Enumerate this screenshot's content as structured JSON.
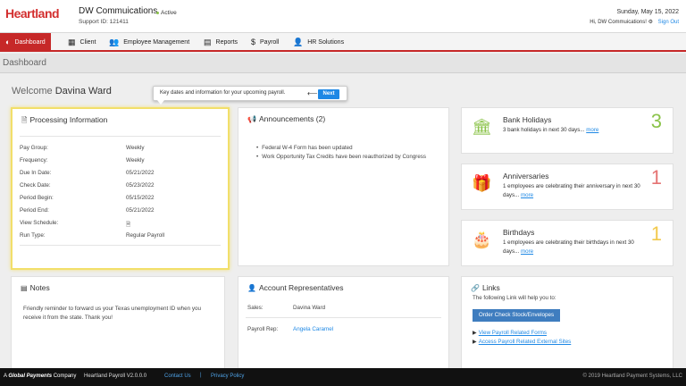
{
  "header": {
    "logo": "Heartland",
    "company": "DW Commuications",
    "status": "Active",
    "support_id": "Support ID: 121411",
    "date": "Sunday, May 15, 2022",
    "greeting": "Hi, DW Commuications!",
    "sign_out": "Sign Out"
  },
  "nav": [
    {
      "label": "Dashboard",
      "icon": "dashboard-icon",
      "glyph": "◐"
    },
    {
      "label": "Client",
      "icon": "building-icon",
      "glyph": "▦"
    },
    {
      "label": "Employee Management",
      "icon": "users-icon",
      "glyph": "👥"
    },
    {
      "label": "Reports",
      "icon": "document-icon",
      "glyph": "▤"
    },
    {
      "label": "Payroll",
      "icon": "dollar-icon",
      "glyph": "$"
    },
    {
      "label": "HR Solutions",
      "icon": "user-icon",
      "glyph": "👤"
    }
  ],
  "breadcrumb": "Dashboard",
  "welcome": {
    "prefix": "Welcome",
    "name": "Davina Ward"
  },
  "tooltip": {
    "text": "Key dates and information for your upcoming payroll.",
    "next": "Next"
  },
  "processing": {
    "title": "Processing Information",
    "rows": [
      {
        "label": "Pay Group:",
        "value": "Weekly"
      },
      {
        "label": "Frequency:",
        "value": "Weekly"
      },
      {
        "label": "Due In Date:",
        "value": "05/21/2022"
      },
      {
        "label": "Check Date:",
        "value": "05/23/2022"
      },
      {
        "label": "Period Begin:",
        "value": "05/15/2022"
      },
      {
        "label": "Period End:",
        "value": "05/21/2022"
      },
      {
        "label": "View Schedule:",
        "value": ""
      },
      {
        "label": "Run Type:",
        "value": "Regular Payroll"
      }
    ]
  },
  "announcements": {
    "title": "Announcements (2)",
    "items": [
      "Federal W-4 Form has been updated",
      "Work Opportunity Tax Credits have been reauthorized by Congress"
    ]
  },
  "holidays": {
    "title": "Bank Holidays",
    "desc": "3 bank holidays in next 30 days...",
    "more": "more",
    "count": "3",
    "color": "#8bc34a"
  },
  "anniversaries": {
    "title": "Anniversaries",
    "desc": "1 employees are celebrating their anniversary in next 30 days...",
    "more": "more",
    "count": "1",
    "color": "#e57373"
  },
  "birthdays": {
    "title": "Birthdays",
    "desc": "1 employees are celebrating their birthdays in next 30 days...",
    "more": "more",
    "count": "1",
    "color": "#f2c94c"
  },
  "notes": {
    "title": "Notes",
    "body": "Friendly reminder to forward us your Texas unemployment ID when you receive it from the state. Thank you!"
  },
  "accounts": {
    "title": "Account Representatives",
    "sales_label": "Sales:",
    "sales_value": "Davina Ward",
    "payroll_label": "Payroll Rep:",
    "payroll_value": "Angela Caramel"
  },
  "links": {
    "title": "Links",
    "intro": "The following Link will help you to:",
    "order_button": "Order Check Stock/Envelopes",
    "link1": "View Payroll Related Forms",
    "link2": "Access Payroll Related External Sites"
  },
  "footer": {
    "brand_prefix": "A",
    "brand_name": "Global Payments",
    "brand_suffix": "Company",
    "version": "Heartland Payroll V2.0.0.0",
    "contact": "Contact Us",
    "privacy": "Privacy Policy",
    "copyright": "© 2019 Heartland Payment Systems, LLC"
  }
}
